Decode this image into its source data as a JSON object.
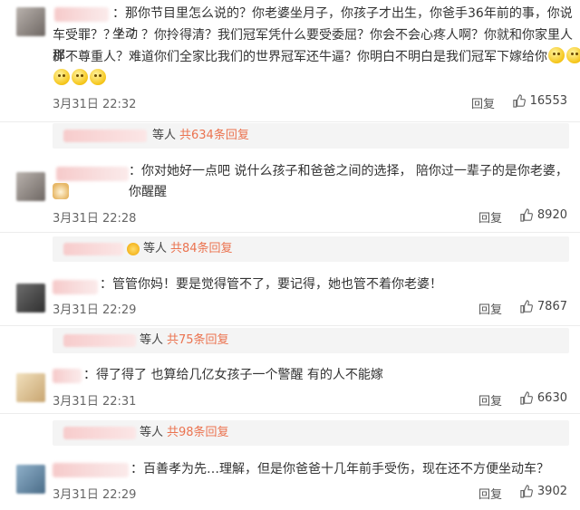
{
  "comments": [
    {
      "text_lines": [
        "：那你节目里怎么说的？你老婆坐月子，你孩子才出生，你爸手36年前的事，你说坐动",
        "车受罪？？？？？你拎得清？我们冠军凭什么要受委屈？你会不会心疼人啊？你就和你家里人那",
        "样不尊重人？难道你们全家比我们的世界冠军还牛逼？你明白不明白是我们冠军下嫁给你"
      ],
      "time": "3月31日 22:32",
      "reply": "回复",
      "likes": "16553",
      "thread_who": "等人",
      "thread_count": "共634条回复"
    },
    {
      "text_lines": [
        "：你对她好一点吧 说什么孩子和爸爸之间的选择， 陪你过一辈子的是你老婆，你醒醒"
      ],
      "time": "3月31日 22:28",
      "reply": "回复",
      "likes": "8920",
      "thread_who": "等人",
      "thread_count": "共84条回复"
    },
    {
      "text_lines": [
        "：管管你妈！要是觉得管不了，要记得，她也管不着你老婆！"
      ],
      "time": "3月31日 22:29",
      "reply": "回复",
      "likes": "7867",
      "thread_who": "等人",
      "thread_count": "共75条回复"
    },
    {
      "text_lines": [
        "：得了得了 也算给几亿女孩子一个警醒 有的人不能嫁"
      ],
      "time": "3月31日 22:31",
      "reply": "回复",
      "likes": "6630",
      "thread_who": "等人",
      "thread_count": "共98条回复"
    },
    {
      "text_lines": [
        "：百善孝为先…理解，但是你爸爸十几年前手受伤，现在还不方便坐动车？"
      ],
      "time": "3月31日 22:29",
      "reply": "回复",
      "likes": "3902"
    }
  ],
  "icons": {
    "like": "thumbs-up-icon",
    "emoji": "smiley-face-icon",
    "dog": "doge-emoji-icon",
    "crown": "crown-badge-icon"
  },
  "colors": {
    "accent": "#eb7350",
    "thread_bg": "#f4f4f4",
    "text": "#333333"
  }
}
